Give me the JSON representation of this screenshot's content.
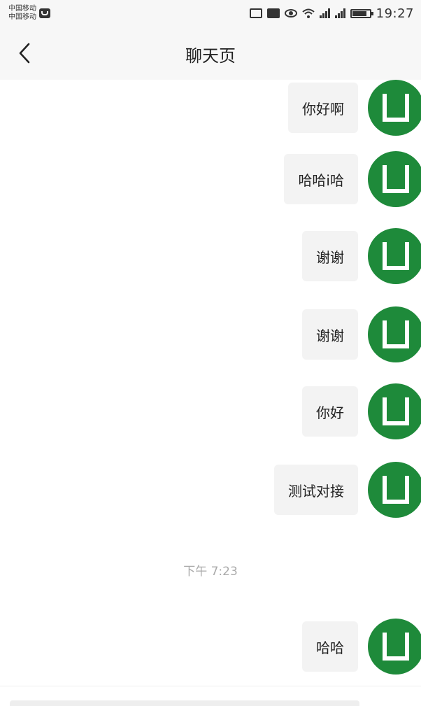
{
  "status_bar": {
    "carrier_1": "中国移动",
    "carrier_2": "中国移动",
    "carrier_icon": "app-notification-icon",
    "icons": [
      "cast-icon",
      "hd-icon",
      "eye-icon",
      "wifi-icon",
      "signal-4g-icon",
      "signal-2g-icon",
      "battery-icon"
    ],
    "time": "19:27"
  },
  "navbar": {
    "back_icon": "chevron-left-icon",
    "title": "聊天页"
  },
  "messages": [
    {
      "text": "你好啊",
      "sender": "self"
    },
    {
      "text": "哈哈i哈",
      "sender": "self"
    },
    {
      "text": "谢谢",
      "sender": "self"
    },
    {
      "text": "谢谢",
      "sender": "self"
    },
    {
      "text": "你好",
      "sender": "self"
    },
    {
      "text": "测试对接",
      "sender": "self"
    },
    {
      "text": "哈哈",
      "sender": "self"
    }
  ],
  "timestamp": "下午 7:23",
  "colors": {
    "avatar": "#1e8a3a",
    "bubble": "#f3f3f3",
    "timestamp": "#aaaaaa"
  }
}
